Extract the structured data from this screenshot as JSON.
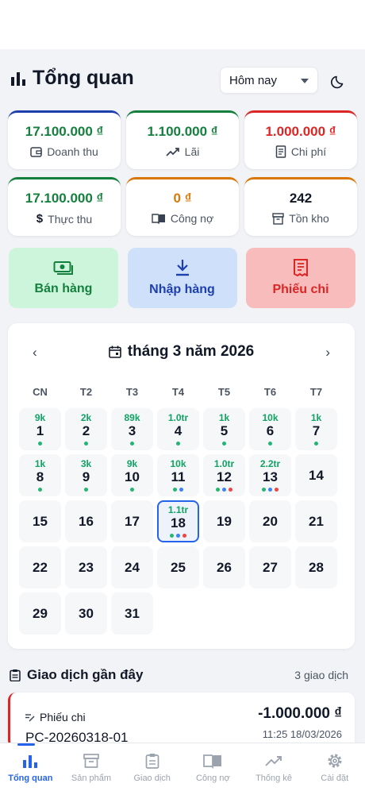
{
  "header": {
    "title": "Tổng quan",
    "period": "Hôm nay"
  },
  "stats": [
    {
      "value": "17.100.000 ₫",
      "label": "Doanh thu",
      "color": "#15803d",
      "accent": "#1e40af",
      "icon": "wallet-icon"
    },
    {
      "value": "1.100.000 ₫",
      "label": "Lãi",
      "color": "#15803d",
      "accent": "#15803d",
      "icon": "trend-up-icon"
    },
    {
      "value": "1.000.000 ₫",
      "label": "Chi phí",
      "color": "#dc2626",
      "accent": "#dc2626",
      "icon": "receipt-icon"
    },
    {
      "value": "17.100.000 ₫",
      "label": "Thực thu",
      "color": "#15803d",
      "accent": "#15803d",
      "icon": "dollar-icon"
    },
    {
      "value": "0 ₫",
      "label": "Công nợ",
      "color": "#d97706",
      "accent": "#d97706",
      "icon": "book-icon"
    },
    {
      "value": "242",
      "label": "Tồn kho",
      "color": "#111827",
      "accent": "#d97706",
      "icon": "box-icon"
    }
  ],
  "actions": {
    "sell": "Bán hàng",
    "import": "Nhập hàng",
    "expense": "Phiếu chi"
  },
  "calendar": {
    "month_label": "tháng 3 năm 2026",
    "weekdays": [
      "CN",
      "T2",
      "T3",
      "T4",
      "T5",
      "T6",
      "T7"
    ],
    "selected_day": 18,
    "days": [
      {
        "day": "1",
        "amount": "9k",
        "dots": [
          "g"
        ]
      },
      {
        "day": "2",
        "amount": "2k",
        "dots": [
          "g"
        ]
      },
      {
        "day": "3",
        "amount": "89k",
        "dots": [
          "g"
        ]
      },
      {
        "day": "4",
        "amount": "1.0tr",
        "dots": [
          "g"
        ]
      },
      {
        "day": "5",
        "amount": "1k",
        "dots": [
          "g"
        ]
      },
      {
        "day": "6",
        "amount": "10k",
        "dots": [
          "g"
        ]
      },
      {
        "day": "7",
        "amount": "1k",
        "dots": [
          "g"
        ]
      },
      {
        "day": "8",
        "amount": "1k",
        "dots": [
          "g"
        ]
      },
      {
        "day": "9",
        "amount": "3k",
        "dots": [
          "g"
        ]
      },
      {
        "day": "10",
        "amount": "9k",
        "dots": [
          "g"
        ]
      },
      {
        "day": "11",
        "amount": "10k",
        "dots": [
          "g",
          "b"
        ]
      },
      {
        "day": "12",
        "amount": "1.0tr",
        "dots": [
          "g",
          "b",
          "r"
        ]
      },
      {
        "day": "13",
        "amount": "2.2tr",
        "dots": [
          "g",
          "b",
          "r"
        ]
      },
      {
        "day": "14",
        "amount": "",
        "dots": []
      },
      {
        "day": "15",
        "amount": "",
        "dots": []
      },
      {
        "day": "16",
        "amount": "",
        "dots": []
      },
      {
        "day": "17",
        "amount": "",
        "dots": []
      },
      {
        "day": "18",
        "amount": "1.1tr",
        "dots": [
          "g",
          "b",
          "r"
        ]
      },
      {
        "day": "19",
        "amount": "",
        "dots": []
      },
      {
        "day": "20",
        "amount": "",
        "dots": []
      },
      {
        "day": "21",
        "amount": "",
        "dots": []
      },
      {
        "day": "22",
        "amount": "",
        "dots": []
      },
      {
        "day": "23",
        "amount": "",
        "dots": []
      },
      {
        "day": "24",
        "amount": "",
        "dots": []
      },
      {
        "day": "25",
        "amount": "",
        "dots": []
      },
      {
        "day": "26",
        "amount": "",
        "dots": []
      },
      {
        "day": "27",
        "amount": "",
        "dots": []
      },
      {
        "day": "28",
        "amount": "",
        "dots": []
      },
      {
        "day": "29",
        "amount": "",
        "dots": []
      },
      {
        "day": "30",
        "amount": "",
        "dots": []
      },
      {
        "day": "31",
        "amount": "",
        "dots": []
      }
    ]
  },
  "recent": {
    "title": "Giao dịch gần đây",
    "count": "3 giao dịch",
    "item": {
      "type": "Phiếu chi",
      "code": "PC-20260318-01",
      "amount": "-1.000.000 ₫",
      "time": "11:25 18/03/2026"
    }
  },
  "tabs": [
    {
      "label": "Tổng quan",
      "name": "tab-overview",
      "icon": "chart-icon"
    },
    {
      "label": "Sản phẩm",
      "name": "tab-products",
      "icon": "archive-icon"
    },
    {
      "label": "Giao dịch",
      "name": "tab-transactions",
      "icon": "clipboard-icon"
    },
    {
      "label": "Công nợ",
      "name": "tab-debts",
      "icon": "book-icon"
    },
    {
      "label": "Thống kê",
      "name": "tab-stats",
      "icon": "trend-up-icon"
    },
    {
      "label": "Cài đặt",
      "name": "tab-settings",
      "icon": "gear-icon"
    }
  ],
  "active_tab": 0,
  "colors": {
    "accent": "#2563eb",
    "green": "#15803d",
    "red": "#dc2626",
    "amber": "#d97706"
  }
}
